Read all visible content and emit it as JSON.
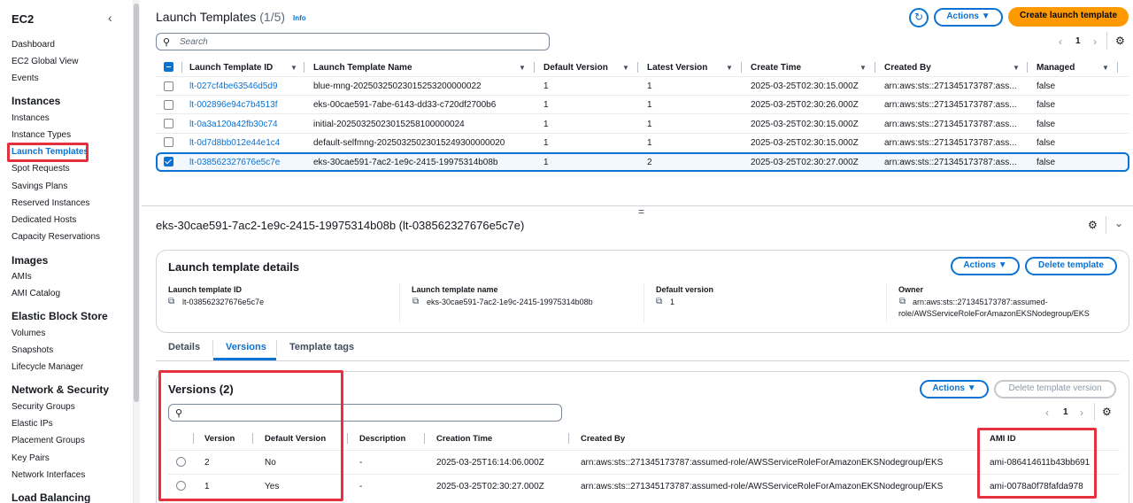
{
  "sidebar": {
    "title": "EC2",
    "items": {
      "dashboard": "Dashboard",
      "global_view": "EC2 Global View",
      "events": "Events",
      "instances_section": "Instances",
      "instances": "Instances",
      "instance_types": "Instance Types",
      "launch_templates": "Launch Templates",
      "spot_requests": "Spot Requests",
      "savings_plans": "Savings Plans",
      "reserved_instances": "Reserved Instances",
      "dedicated_hosts": "Dedicated Hosts",
      "capacity_reservations": "Capacity Reservations",
      "images_section": "Images",
      "amis": "AMIs",
      "ami_catalog": "AMI Catalog",
      "ebs_section": "Elastic Block Store",
      "volumes": "Volumes",
      "snapshots": "Snapshots",
      "lifecycle_manager": "Lifecycle Manager",
      "netsec_section": "Network & Security",
      "security_groups": "Security Groups",
      "elastic_ips": "Elastic IPs",
      "placement_groups": "Placement Groups",
      "key_pairs": "Key Pairs",
      "network_interfaces": "Network Interfaces",
      "lb_section": "Load Balancing"
    }
  },
  "header": {
    "title": "Launch Templates",
    "count": "(1/5)",
    "info": "Info",
    "actions": "Actions ▼",
    "create": "Create launch template",
    "search_placeholder": "Search",
    "page": "1"
  },
  "table": {
    "columns": [
      "Launch Template ID",
      "Launch Template Name",
      "Default Version",
      "Latest Version",
      "Create Time",
      "Created By",
      "Managed"
    ],
    "rows": [
      {
        "id": "lt-027cf4be63546d5d9",
        "name": "blue-mng-20250325023015253200000022",
        "default": "1",
        "latest": "1",
        "time": "2025-03-25T02:30:15.000Z",
        "by": "arn:aws:sts::271345173787:ass...",
        "managed": "false",
        "selected": false
      },
      {
        "id": "lt-002896e94c7b4513f",
        "name": "eks-00cae591-7abe-6143-dd33-c720df2700b6",
        "default": "1",
        "latest": "1",
        "time": "2025-03-25T02:30:26.000Z",
        "by": "arn:aws:sts::271345173787:ass...",
        "managed": "false",
        "selected": false
      },
      {
        "id": "lt-0a3a120a42fb30c74",
        "name": "initial-20250325023015258100000024",
        "default": "1",
        "latest": "1",
        "time": "2025-03-25T02:30:15.000Z",
        "by": "arn:aws:sts::271345173787:ass...",
        "managed": "false",
        "selected": false
      },
      {
        "id": "lt-0d7d8bb012e44e1c4",
        "name": "default-selfmng-20250325023015249300000020",
        "default": "1",
        "latest": "1",
        "time": "2025-03-25T02:30:15.000Z",
        "by": "arn:aws:sts::271345173787:ass...",
        "managed": "false",
        "selected": false
      },
      {
        "id": "lt-038562327676e5c7e",
        "name": "eks-30cae591-7ac2-1e9c-2415-19975314b08b",
        "default": "1",
        "latest": "2",
        "time": "2025-03-25T02:30:27.000Z",
        "by": "arn:aws:sts::271345173787:ass...",
        "managed": "false",
        "selected": true
      }
    ]
  },
  "divider_handle": "=",
  "detail": {
    "title": "eks-30cae591-7ac2-1e9c-2415-19975314b08b (lt-038562327676e5c7e)",
    "panel_title": "Launch template details",
    "actions": "Actions ▼",
    "delete": "Delete template",
    "fields": {
      "id_label": "Launch template ID",
      "id_value": "lt-038562327676e5c7e",
      "name_label": "Launch template name",
      "name_value": "eks-30cae591-7ac2-1e9c-2415-19975314b08b",
      "default_label": "Default version",
      "default_value": "1",
      "owner_label": "Owner",
      "owner_line1": "arn:aws:sts::271345173787:assumed-",
      "owner_line2": "role/AWSServiceRoleForAmazonEKSNodegroup/EKS"
    },
    "tabs": [
      "Details",
      "Versions",
      "Template tags"
    ]
  },
  "versions": {
    "title": "Versions (2)",
    "actions": "Actions ▼",
    "delete": "Delete template version",
    "page": "1",
    "columns": [
      "Version",
      "Default Version",
      "Description",
      "Creation Time",
      "Created By",
      "AMI ID"
    ],
    "rows": [
      {
        "version": "2",
        "default": "No",
        "desc": "-",
        "time": "2025-03-25T16:14:06.000Z",
        "by": "arn:aws:sts::271345173787:assumed-role/AWSServiceRoleForAmazonEKSNodegroup/EKS",
        "ami": "ami-086414611b43bb691"
      },
      {
        "version": "1",
        "default": "Yes",
        "desc": "-",
        "time": "2025-03-25T02:30:27.000Z",
        "by": "arn:aws:sts::271345173787:assumed-role/AWSServiceRoleForAmazonEKSNodegroup/EKS",
        "ami": "ami-0078a0f78fafda978"
      }
    ]
  },
  "colors": {
    "accent": "#0972d3",
    "primary_button": "#ff9900",
    "highlight": "#e5313d"
  }
}
